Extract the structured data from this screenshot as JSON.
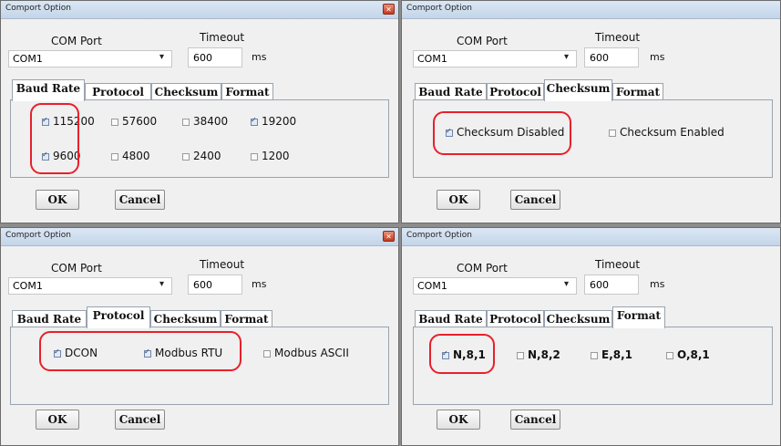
{
  "dialogs": [
    {
      "title": "Comport Option",
      "com_port_label": "COM Port",
      "com_port_value": "COM1",
      "timeout_label": "Timeout",
      "timeout_value": "600",
      "timeout_unit": "ms",
      "tabs": [
        "Baud Rate",
        "Protocol",
        "Checksum",
        "Format"
      ],
      "active_tab": "Baud Rate",
      "options": [
        {
          "label": "115200",
          "checked": true
        },
        {
          "label": "57600",
          "checked": false
        },
        {
          "label": "38400",
          "checked": false
        },
        {
          "label": "19200",
          "checked": true
        },
        {
          "label": "9600",
          "checked": true
        },
        {
          "label": "4800",
          "checked": false
        },
        {
          "label": "2400",
          "checked": false
        },
        {
          "label": "1200",
          "checked": false
        }
      ],
      "ok_label": "OK",
      "cancel_label": "Cancel"
    },
    {
      "title": "Comport Option",
      "com_port_label": "COM Port",
      "com_port_value": "COM1",
      "timeout_label": "Timeout",
      "timeout_value": "600",
      "timeout_unit": "ms",
      "tabs": [
        "Baud Rate",
        "Protocol",
        "Checksum",
        "Format"
      ],
      "active_tab": "Checksum",
      "options": [
        {
          "label": "Checksum Disabled",
          "checked": true
        },
        {
          "label": "Checksum Enabled",
          "checked": false
        }
      ],
      "ok_label": "OK",
      "cancel_label": "Cancel"
    },
    {
      "title": "Comport Option",
      "com_port_label": "COM Port",
      "com_port_value": "COM1",
      "timeout_label": "Timeout",
      "timeout_value": "600",
      "timeout_unit": "ms",
      "tabs": [
        "Baud Rate",
        "Protocol",
        "Checksum",
        "Format"
      ],
      "active_tab": "Protocol",
      "options": [
        {
          "label": "DCON",
          "checked": true
        },
        {
          "label": "Modbus RTU",
          "checked": true
        },
        {
          "label": "Modbus ASCII",
          "checked": false
        }
      ],
      "ok_label": "OK",
      "cancel_label": "Cancel"
    },
    {
      "title": "Comport Option",
      "com_port_label": "COM Port",
      "com_port_value": "COM1",
      "timeout_label": "Timeout",
      "timeout_value": "600",
      "timeout_unit": "ms",
      "tabs": [
        "Baud Rate",
        "Protocol",
        "Checksum",
        "Format"
      ],
      "active_tab": "Format",
      "options": [
        {
          "label": "N,8,1",
          "checked": true
        },
        {
          "label": "N,8,2",
          "checked": false
        },
        {
          "label": "E,8,1",
          "checked": false
        },
        {
          "label": "O,8,1",
          "checked": false
        }
      ],
      "ok_label": "OK",
      "cancel_label": "Cancel"
    }
  ],
  "colors": {
    "highlight": "#e8202a",
    "dialog_bg": "#f0f0f0",
    "title_bar": "#c4d5ea"
  }
}
